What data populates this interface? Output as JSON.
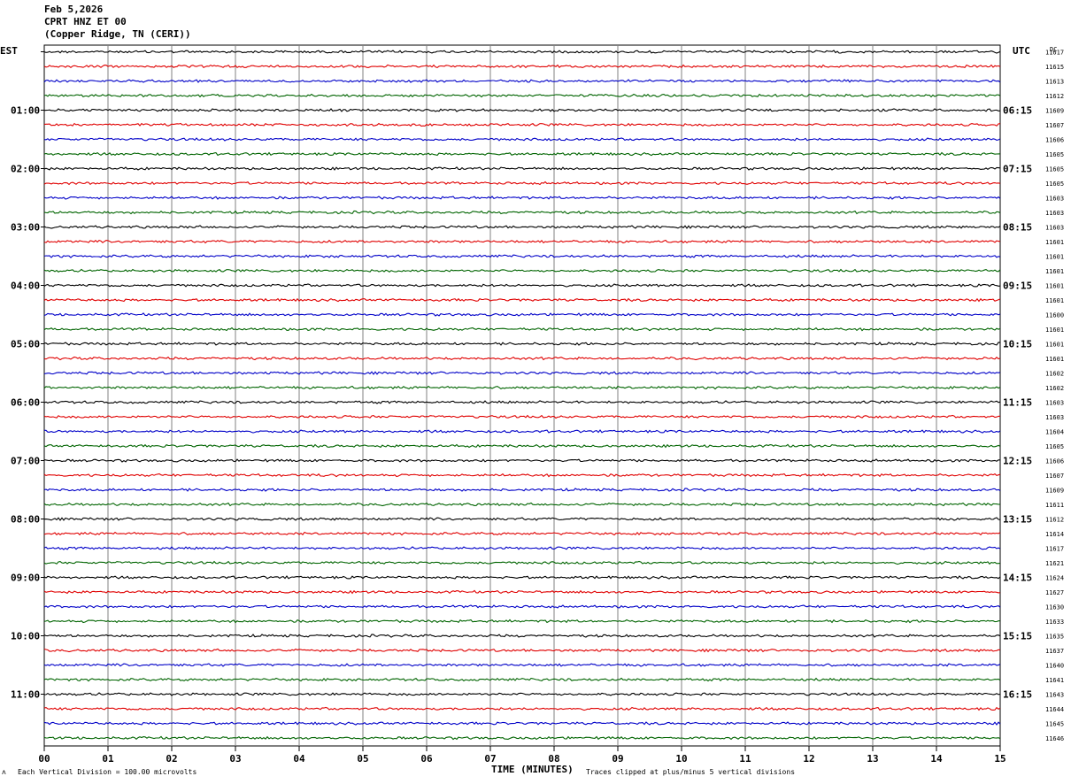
{
  "header": {
    "date": "Feb 5,2026",
    "channel": "CPRT HNZ ET 00",
    "location": "(Copper Ridge, TN (CERI))"
  },
  "axis": {
    "left_label": "EST",
    "right_label": "UTC",
    "dc_label": "DC",
    "x_title": "TIME (MINUTES)"
  },
  "footer": {
    "scale_note": "Each Vertical Division =  100.00 microvolts",
    "clip_note": "Traces clipped at plus/minus 5 vertical divisions"
  },
  "colors": {
    "trace_cycle": [
      "#000000",
      "#e00000",
      "#0000c8",
      "#006400"
    ],
    "grid": "#808080"
  },
  "chart_data": {
    "type": "line",
    "title": "",
    "xlabel": "TIME (MINUTES)",
    "xlim": [
      0,
      15
    ],
    "x_ticks": [
      "00",
      "01",
      "02",
      "03",
      "04",
      "05",
      "06",
      "07",
      "08",
      "09",
      "10",
      "11",
      "12",
      "13",
      "14",
      "15"
    ],
    "row_count": 48,
    "row_interval_minutes": 15,
    "left_hour_labels": [
      "01:00",
      "02:00",
      "03:00",
      "04:00",
      "05:00",
      "06:00",
      "07:00",
      "08:00",
      "09:00",
      "10:00",
      "11:00"
    ],
    "right_hour_labels": [
      "06:15",
      "07:15",
      "08:15",
      "09:15",
      "10:15",
      "11:15",
      "12:15",
      "13:15",
      "14:15",
      "15:15",
      "16:15"
    ],
    "dc_values": [
      "11617",
      "11615",
      "11613",
      "11612",
      "11609",
      "11607",
      "11606",
      "11605",
      "11605",
      "11605",
      "11603",
      "11603",
      "11603",
      "11601",
      "11601",
      "11601",
      "11601",
      "11601",
      "11600",
      "11601",
      "11601",
      "11601",
      "11602",
      "11602",
      "11603",
      "11603",
      "11604",
      "11605",
      "11606",
      "11607",
      "11609",
      "11611",
      "11612",
      "11614",
      "11617",
      "11621",
      "11624",
      "11627",
      "11630",
      "11633",
      "11635",
      "11637",
      "11640",
      "11641",
      "11643",
      "11644",
      "11645",
      "11646"
    ]
  }
}
